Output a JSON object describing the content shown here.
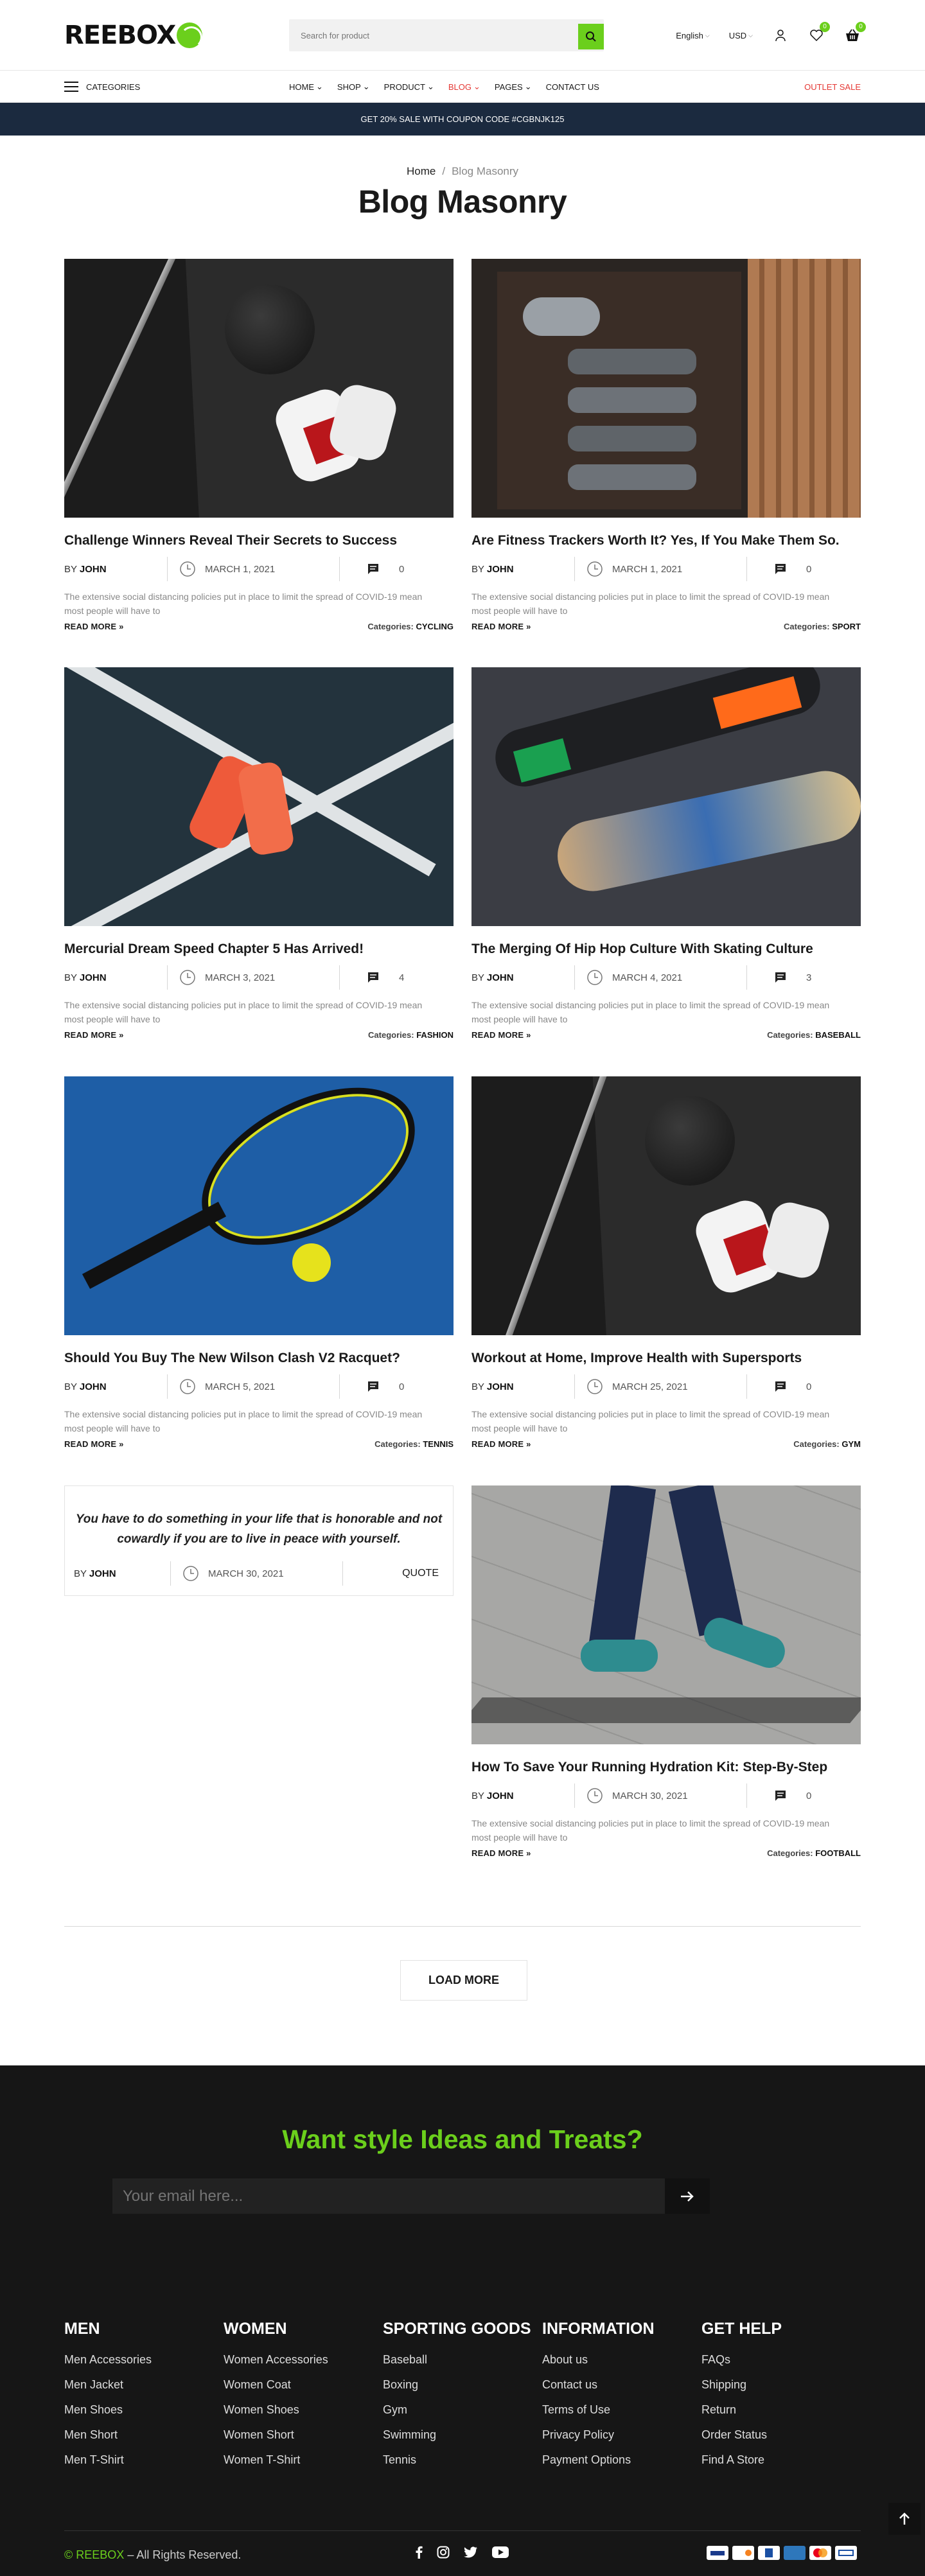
{
  "header": {
    "logo": "REEBOX",
    "search_placeholder": "Search for product",
    "language": "English",
    "currency": "USD",
    "wishlist_count": "0",
    "cart_count": "0"
  },
  "nav": {
    "categories": "CATEGORIES",
    "items": [
      "HOME",
      "SHOP",
      "PRODUCT",
      "BLOG",
      "PAGES",
      "CONTACT US"
    ],
    "outlet": "OUTLET SALE"
  },
  "banner": "GET 20% SALE WITH COUPON CODE #CGBNJK125",
  "breadcrumb": {
    "home": "Home",
    "sep": "/",
    "current": "Blog Masonry"
  },
  "page_title": "Blog Masonry",
  "posts": [
    {
      "title": "Challenge Winners Reveal Their Secrets to Success",
      "by": "BY",
      "author": "JOHN",
      "date": "MARCH 1, 2021",
      "comments": "0",
      "excerpt": "The extensive social distancing policies put in place to limit the spread of COVID-19 mean most people will have to",
      "read_more": "READ MORE",
      "cat_label": "Categories:",
      "category": "CYCLING"
    },
    {
      "title": "Are Fitness Trackers Worth It? Yes, If You Make Them So.",
      "by": "BY",
      "author": "JOHN",
      "date": "MARCH 1, 2021",
      "comments": "0",
      "excerpt": "The extensive social distancing policies put in place to limit the spread of COVID-19 mean most people will have to",
      "read_more": "READ MORE",
      "cat_label": "Categories:",
      "category": "SPORT"
    },
    {
      "title": "Mercurial Dream Speed Chapter 5 Has Arrived!",
      "by": "BY",
      "author": "JOHN",
      "date": "MARCH 3, 2021",
      "comments": "4",
      "excerpt": "The extensive social distancing policies put in place to limit the spread of COVID-19 mean most people will have to",
      "read_more": "READ MORE",
      "cat_label": "Categories:",
      "category": "FASHION"
    },
    {
      "title": "The Merging Of Hip Hop Culture With Skating Culture",
      "by": "BY",
      "author": "JOHN",
      "date": "MARCH 4, 2021",
      "comments": "3",
      "excerpt": "The extensive social distancing policies put in place to limit the spread of COVID-19 mean most people will have to",
      "read_more": "READ MORE",
      "cat_label": "Categories:",
      "category": "BASEBALL"
    },
    {
      "title": "Should You Buy The New Wilson Clash V2 Racquet?",
      "by": "BY",
      "author": "JOHN",
      "date": "MARCH 5, 2021",
      "comments": "0",
      "excerpt": "The extensive social distancing policies put in place to limit the spread of COVID-19 mean most people will have to",
      "read_more": "READ MORE",
      "cat_label": "Categories:",
      "category": "TENNIS"
    },
    {
      "title": "Workout at Home, Improve Health with Supersports",
      "by": "BY",
      "author": "JOHN",
      "date": "MARCH 25, 2021",
      "comments": "0",
      "excerpt": "The extensive social distancing policies put in place to limit the spread of COVID-19 mean most people will have to",
      "read_more": "READ MORE",
      "cat_label": "Categories:",
      "category": "GYM"
    },
    {
      "title": "How To Save Your Running Hydration Kit: Step-By-Step",
      "by": "BY",
      "author": "JOHN",
      "date": "MARCH 30, 2021",
      "comments": "0",
      "excerpt": "The extensive social distancing policies put in place to limit the spread of COVID-19 mean most people will have to",
      "read_more": "READ MORE",
      "cat_label": "Categories:",
      "category": "FOOTBALL"
    }
  ],
  "quote_post": {
    "text": "You have to do something in your life that is honorable and not cowardly if you are to live in peace with yourself.",
    "by": "BY",
    "author": "JOHN",
    "date": "MARCH 30, 2021",
    "label": "QUOTE"
  },
  "load_more": "LOAD MORE",
  "footer": {
    "newsletter_title": "Want style Ideas and Treats?",
    "email_placeholder": "Your email here...",
    "columns": [
      {
        "title": "MEN",
        "links": [
          "Men Accessories",
          "Men Jacket",
          "Men Shoes",
          "Men Short",
          "Men T-Shirt"
        ]
      },
      {
        "title": "WOMEN",
        "links": [
          "Women Accessories",
          "Women Coat",
          "Women Shoes",
          "Women Short",
          "Women T-Shirt"
        ]
      },
      {
        "title": "SPORTING GOODS",
        "links": [
          "Baseball",
          "Boxing",
          "Gym",
          "Swimming",
          "Tennis"
        ]
      },
      {
        "title": "INFORMATION",
        "links": [
          "About us",
          "Contact us",
          "Terms of Use",
          "Privacy Policy",
          "Payment Options"
        ]
      },
      {
        "title": "GET HELP",
        "links": [
          "FAQs",
          "Shipping",
          "Return",
          "Order Status",
          "Find A Store"
        ]
      }
    ],
    "copyright_prefix": "©",
    "copyright_brand": "REEBOX",
    "copyright_suffix": " – All Rights Reserved.",
    "payment_icons": [
      "visa-icon",
      "discover-icon",
      "paypal-icon",
      "amex-icon",
      "mastercard-icon",
      "card-icon"
    ]
  },
  "colors": {
    "accent": "#6bcf1c",
    "sale": "#e53935",
    "banner": "#1b2a3f",
    "footer": "#161616"
  }
}
